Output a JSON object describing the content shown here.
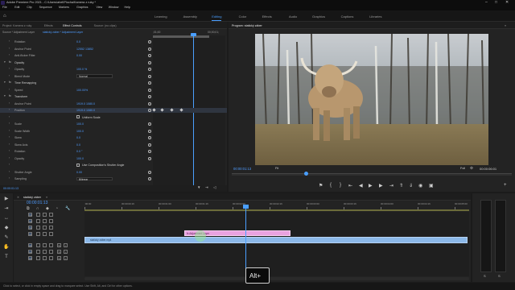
{
  "app": {
    "title": "Adobe Premiere Pro 2021 - C:\\Users\\ahel\\Plocha\\Kamera z ruky *"
  },
  "menu": [
    "File",
    "Edit",
    "Clip",
    "Sequence",
    "Markers",
    "Graphics",
    "View",
    "Window",
    "Help"
  ],
  "workspaces": [
    "Learning",
    "Assembly",
    "Editing",
    "Color",
    "Effects",
    "Audio",
    "Graphics",
    "Captions",
    "Libraries"
  ],
  "workspace_active": "Editing",
  "effect_panel": {
    "tabs": [
      "Project: Kamera z ruky",
      "Effects",
      "Effect Controls",
      "Source: (no clips)"
    ],
    "active_tab": "Effect Controls",
    "source_label": "Source * Adjustment Layer",
    "clip_label": "statický záber * Adjustment Layer",
    "time_start": ";01;00",
    "time_end": "00;00;01;",
    "rows": [
      {
        "label": "Rotation",
        "value": "0.0"
      },
      {
        "label": "Anchor Point",
        "value": "12552    13852"
      },
      {
        "label": "Anti-flicker Filter",
        "value": "0.00"
      },
      {
        "label": "Opacity",
        "value": "",
        "section": true
      },
      {
        "label": "Opacity",
        "value": "100.0 %"
      },
      {
        "label": "Blend Mode",
        "value": "Normal",
        "dropdown": true
      },
      {
        "label": "Time Remapping",
        "value": "",
        "section": true
      },
      {
        "label": "Speed",
        "value": "100.00%"
      },
      {
        "label": "Transform",
        "value": "",
        "section": true
      },
      {
        "label": "Anchor Point",
        "value": "1919.0    1080.0"
      },
      {
        "label": "Position",
        "value": "1919.0    1080.0",
        "highlight": true
      },
      {
        "label": "Uniform Scale",
        "value": "",
        "check": true
      },
      {
        "label": "Scale",
        "value": "100.0"
      },
      {
        "label": "Scale Width",
        "value": "100.0"
      },
      {
        "label": "Skew",
        "value": "0.0"
      },
      {
        "label": "Skew Axis",
        "value": "0.0"
      },
      {
        "label": "Rotation",
        "value": "0.0 °"
      },
      {
        "label": "Opacity",
        "value": "100.0"
      },
      {
        "label": "Use Composition's Shutter Angle",
        "value": "",
        "check": true
      },
      {
        "label": "Shutter Angle",
        "value": "0.00"
      },
      {
        "label": "Sampling",
        "value": "Bilinear",
        "dropdown": true
      }
    ],
    "uniform_scale_text": "Uniform Scale",
    "footer_time": "00:00:01:13"
  },
  "program": {
    "title": "Program: statický záber",
    "timecode": "00:00:01:13",
    "fit": "Fit",
    "quality": "Full",
    "duration": "00:00:06:01"
  },
  "timeline": {
    "tab": "statický záber",
    "timecode": "00:00:01:13",
    "ruler": [
      ":00:00",
      "00:00:00:16",
      "00:00:01:00",
      "00:00:01:16",
      "00:00:02:00",
      "00:00:02:16",
      "00:00:03:00",
      "00:00:03:16",
      "00:00:04:00",
      "00:00:04:16",
      "00:00:05:00"
    ],
    "video_tracks": [
      "V4",
      "V3",
      "V2",
      "V1"
    ],
    "audio_tracks": [
      "A1",
      "A2",
      "A3"
    ],
    "clip_adjust": "fx Adjustment Layer",
    "clip_video": "statický záber.mp4",
    "status": "Click to select, or click in empty space and drag to marquee select. Use Shift, Alt, and Ctrl for other options."
  },
  "tools": [
    "▶",
    "⇥",
    "↔",
    "◆",
    "✎",
    "✋",
    "T"
  ],
  "keystroke": "Alt+",
  "colors": {
    "accent": "#4a9fff",
    "adjustment_clip": "#e9a2e0",
    "video_clip": "#8bb8e8"
  }
}
